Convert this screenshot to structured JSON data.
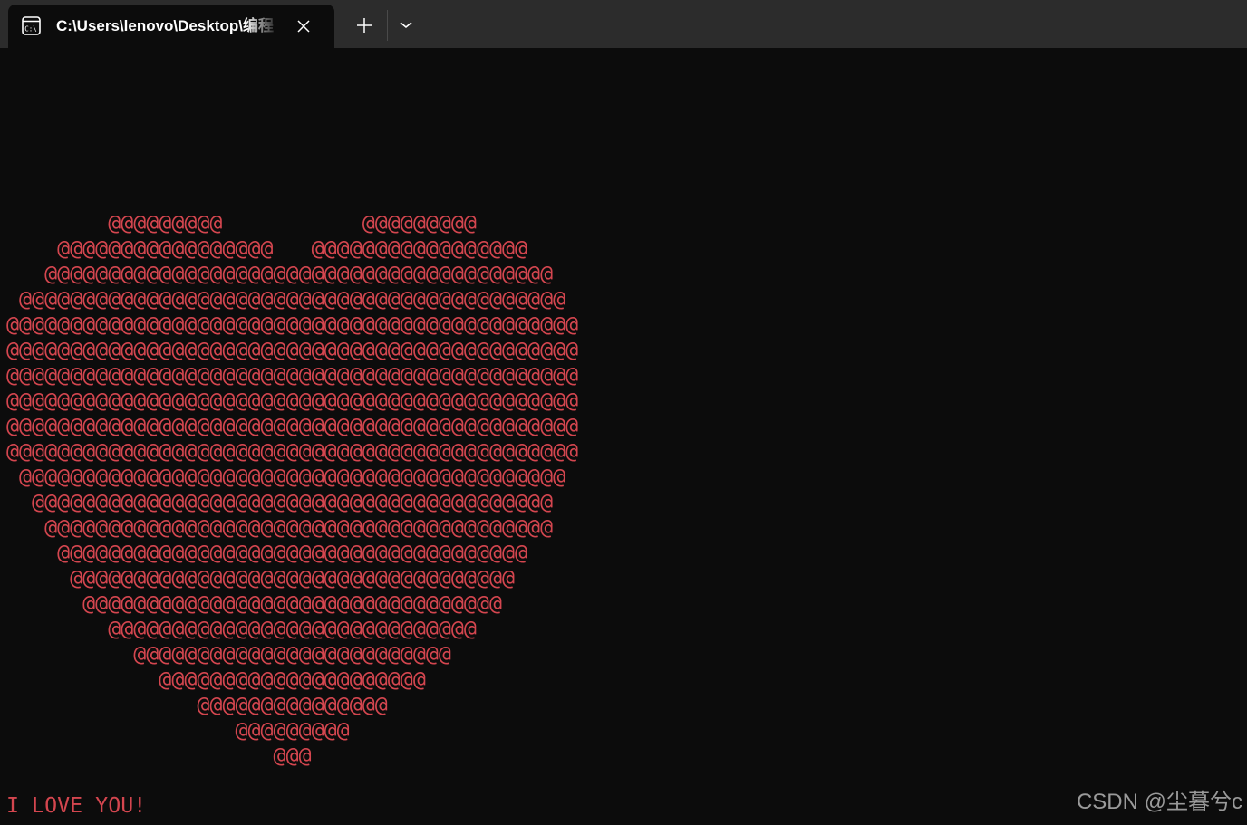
{
  "window": {
    "tab_title": "C:\\Users\\lenovo\\Desktop\\编程",
    "icons": {
      "tab": "terminal-icon",
      "close": "close-icon",
      "new_tab": "plus-icon",
      "dropdown": "chevron-down-icon"
    }
  },
  "console": {
    "text_color": "#d4464f",
    "background": "#0c0c0c",
    "heart_lines": [
      "",
      "",
      "",
      "",
      "        @@@@@@@@@           @@@@@@@@@",
      "    @@@@@@@@@@@@@@@@@   @@@@@@@@@@@@@@@@@",
      "   @@@@@@@@@@@@@@@@@@@@@@@@@@@@@@@@@@@@@@@@",
      " @@@@@@@@@@@@@@@@@@@@@@@@@@@@@@@@@@@@@@@@@@@",
      "@@@@@@@@@@@@@@@@@@@@@@@@@@@@@@@@@@@@@@@@@@@@@",
      "@@@@@@@@@@@@@@@@@@@@@@@@@@@@@@@@@@@@@@@@@@@@@",
      "@@@@@@@@@@@@@@@@@@@@@@@@@@@@@@@@@@@@@@@@@@@@@",
      "@@@@@@@@@@@@@@@@@@@@@@@@@@@@@@@@@@@@@@@@@@@@@",
      "@@@@@@@@@@@@@@@@@@@@@@@@@@@@@@@@@@@@@@@@@@@@@",
      "@@@@@@@@@@@@@@@@@@@@@@@@@@@@@@@@@@@@@@@@@@@@@",
      " @@@@@@@@@@@@@@@@@@@@@@@@@@@@@@@@@@@@@@@@@@@",
      "  @@@@@@@@@@@@@@@@@@@@@@@@@@@@@@@@@@@@@@@@@",
      "   @@@@@@@@@@@@@@@@@@@@@@@@@@@@@@@@@@@@@@@@",
      "    @@@@@@@@@@@@@@@@@@@@@@@@@@@@@@@@@@@@@",
      "     @@@@@@@@@@@@@@@@@@@@@@@@@@@@@@@@@@@",
      "      @@@@@@@@@@@@@@@@@@@@@@@@@@@@@@@@@",
      "        @@@@@@@@@@@@@@@@@@@@@@@@@@@@@",
      "          @@@@@@@@@@@@@@@@@@@@@@@@@",
      "            @@@@@@@@@@@@@@@@@@@@@",
      "               @@@@@@@@@@@@@@@",
      "                  @@@@@@@@@",
      "                     @@@"
    ],
    "message": "I LOVE YOU!"
  },
  "watermark": "CSDN @尘暮兮c"
}
